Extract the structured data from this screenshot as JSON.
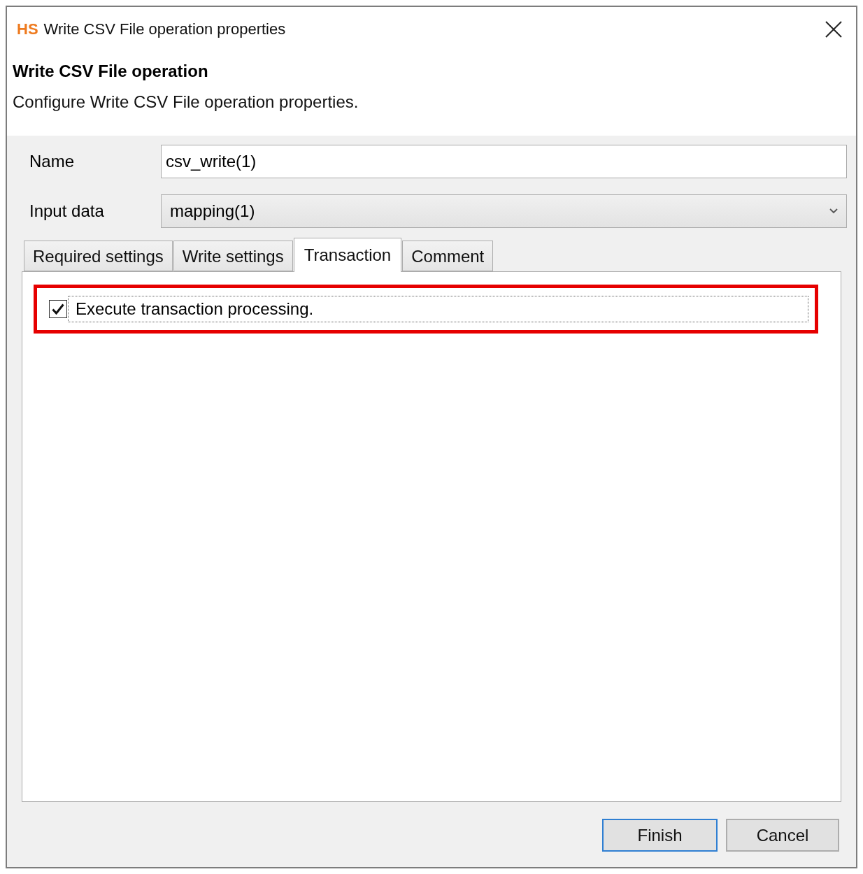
{
  "window": {
    "logo": "HS",
    "title": "Write CSV File operation properties"
  },
  "header": {
    "title": "Write CSV File operation",
    "description": "Configure Write CSV File operation properties."
  },
  "fields": [
    {
      "kind": "text",
      "label": "Name",
      "value": "csv_write(1)"
    },
    {
      "kind": "select",
      "label": "Input data",
      "value": "mapping(1)"
    }
  ],
  "tabs": [
    {
      "label": "Required settings",
      "selected": false
    },
    {
      "label": "Write settings",
      "selected": false
    },
    {
      "label": "Transaction",
      "selected": true
    },
    {
      "label": "Comment",
      "selected": false
    }
  ],
  "panel": {
    "options": [
      {
        "label": "Execute transaction processing.",
        "checked": true,
        "focused": true,
        "highlighted": true
      }
    ]
  },
  "buttons": [
    {
      "label": "Finish",
      "default": true
    },
    {
      "label": "Cancel",
      "default": false
    }
  ]
}
